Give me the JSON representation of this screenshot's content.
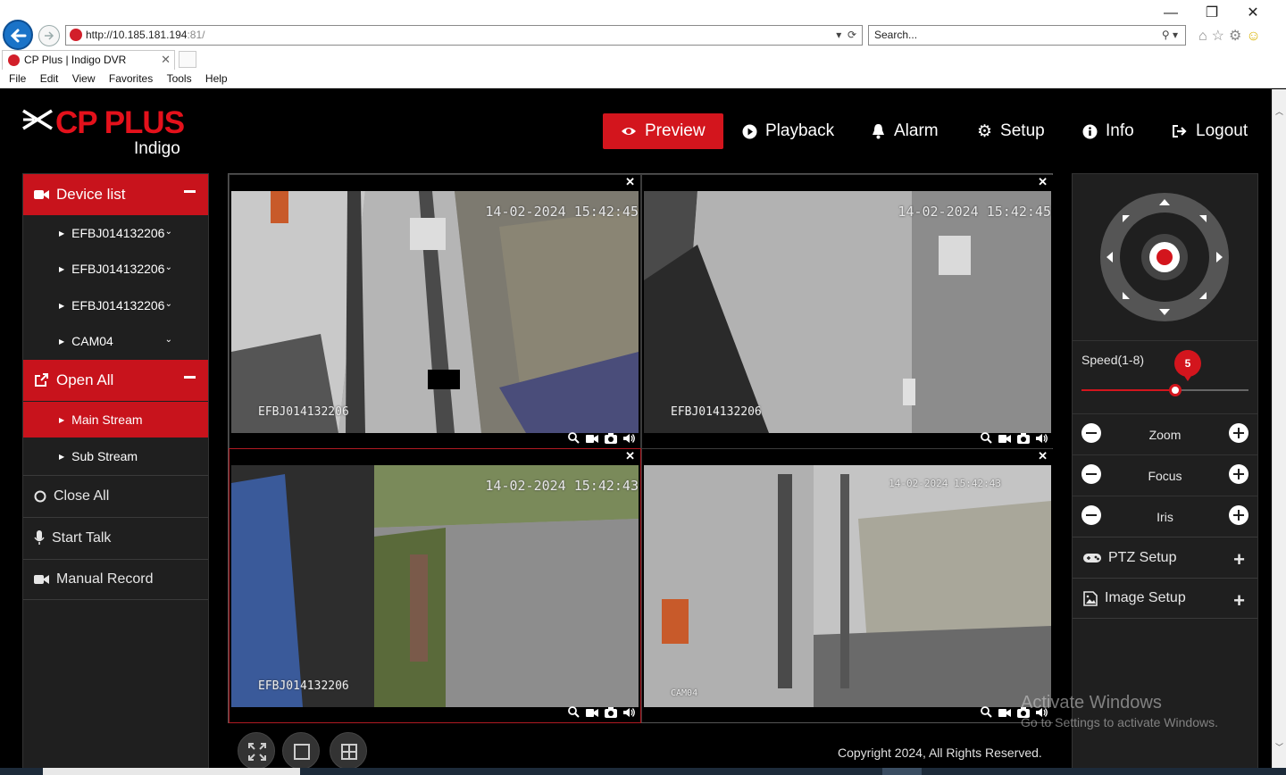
{
  "browser": {
    "url_host": "http://10.185.181.194",
    "url_port": ":81/",
    "search_placeholder": "Search...",
    "tab_title": "CP Plus | Indigo DVR",
    "menu": [
      "File",
      "Edit",
      "View",
      "Favorites",
      "Tools",
      "Help"
    ]
  },
  "brand": {
    "name": "CP PLUS",
    "sub": "Indigo"
  },
  "nav": {
    "preview": "Preview",
    "playback": "Playback",
    "alarm": "Alarm",
    "setup": "Setup",
    "info": "Info",
    "logout": "Logout"
  },
  "sidebar": {
    "device_list": "Device list",
    "devices": [
      "EFBJ014132206",
      "EFBJ014132206",
      "EFBJ014132206",
      "CAM04"
    ],
    "open_all": "Open All",
    "main_stream": "Main Stream",
    "sub_stream": "Sub Stream",
    "close_all": "Close All",
    "start_talk": "Start Talk",
    "manual_record": "Manual Record"
  },
  "cameras": [
    {
      "timestamp": "14-02-2024 15:42:45",
      "name": "EFBJ014132206"
    },
    {
      "timestamp": "14-02-2024 15:42:45",
      "name": "EFBJ014132206"
    },
    {
      "timestamp": "14-02-2024 15:42:43",
      "name": "EFBJ014132206"
    },
    {
      "timestamp": "14-02-2024 15:42:43",
      "name": "CAM04"
    }
  ],
  "ptz": {
    "speed_label": "Speed(1-8)",
    "speed_value": "5",
    "speed_min": 1,
    "speed_max": 8,
    "zoom": "Zoom",
    "focus": "Focus",
    "iris": "Iris",
    "ptz_setup": "PTZ Setup",
    "image_setup": "Image Setup"
  },
  "footer": {
    "copyright": "Copyright 2024, All Rights Reserved."
  },
  "os": {
    "activate_title": "Activate Windows",
    "activate_sub": "Go to Settings to activate Windows."
  },
  "colors": {
    "accent": "#d3151d",
    "panel": "#1f1f1f",
    "background": "#000000"
  }
}
